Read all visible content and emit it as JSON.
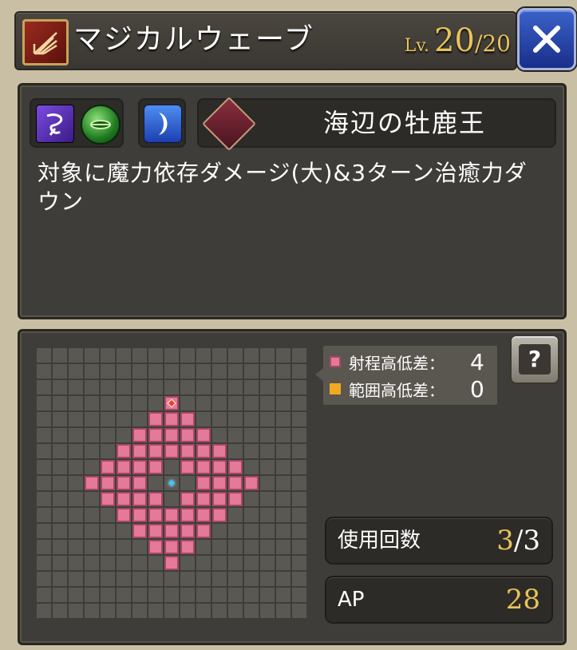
{
  "header": {
    "skill_icon": "wave-slash-icon",
    "title": "マジカルウェーブ",
    "level_prefix": "Lv.",
    "level_current": "20",
    "level_max": "/20"
  },
  "info": {
    "icons": [
      "dark-element-icon",
      "wind-element-icon",
      "moon-icon"
    ],
    "equip_icon": "tome-icon",
    "equipment_name": "海辺の牡鹿王",
    "description": "対象に魔力依存ダメージ(大)&3ターン治癒力ダウン"
  },
  "range": {
    "legend": [
      {
        "label": "射程高低差：",
        "value": "4",
        "swatch": "#e5799a"
      },
      {
        "label": "範囲高低差：",
        "value": "0",
        "swatch": "#f2a922"
      }
    ],
    "grid_cols": 17,
    "grid_rows": 17,
    "uses_label": "使用回数",
    "uses_current": "3",
    "uses_sep_max": "/3",
    "ap_label": "AP",
    "ap_value": "28"
  }
}
